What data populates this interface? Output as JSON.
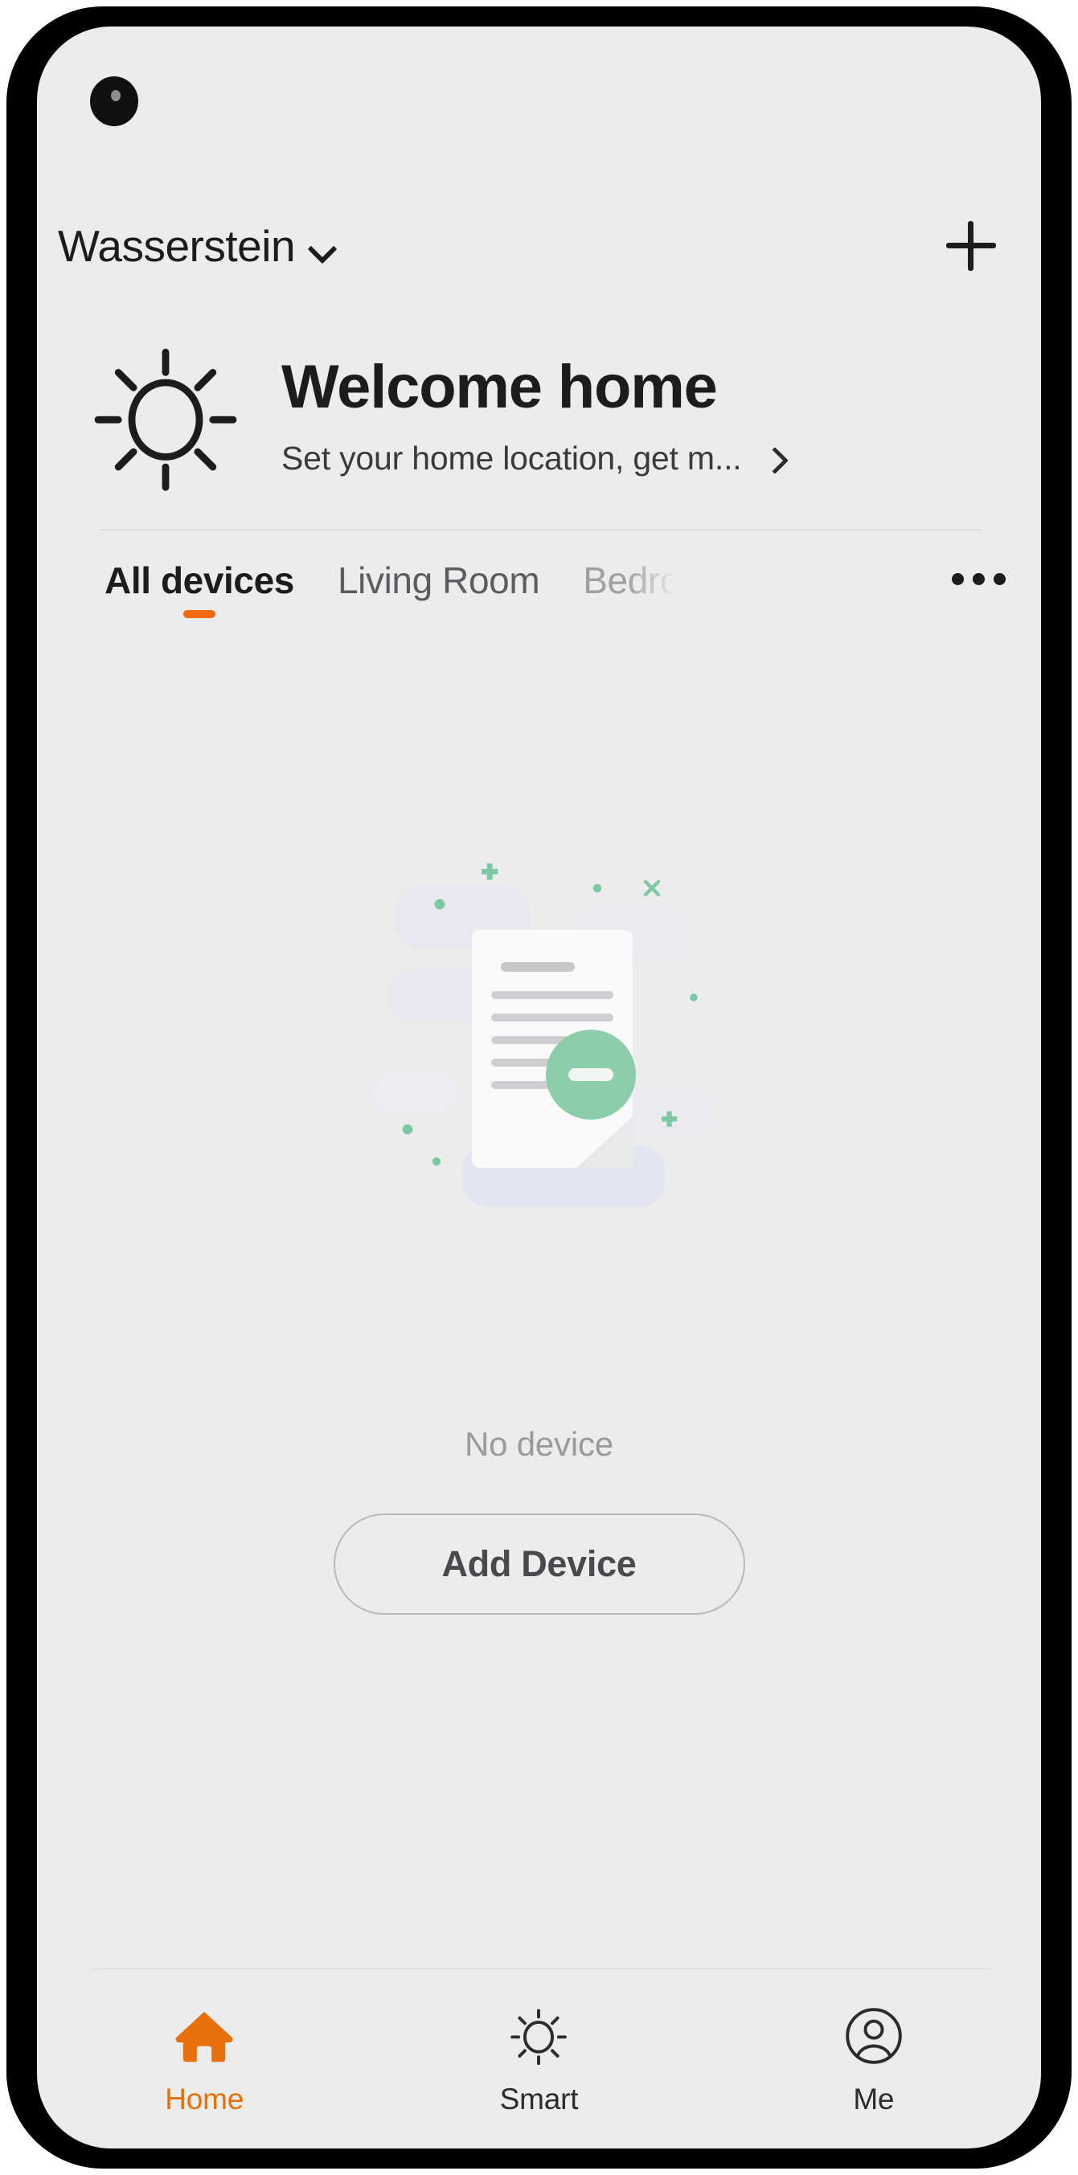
{
  "colors": {
    "accent_orange": "#E8700A",
    "tab_underline": "#F06A10",
    "screen_bg": "#ECECEC",
    "bezel": "#000000",
    "text_primary": "#1c1c1e",
    "text_muted": "#9a9a9e",
    "illus_green": "#7BC9A4",
    "illus_blue": "#E4E6F4"
  },
  "status": {
    "camera_icon": "front-camera-punch-hole"
  },
  "topbar": {
    "home_name": "Wasserstein",
    "dropdown_icon": "chevron-down-icon",
    "add_icon": "plus-icon"
  },
  "welcome": {
    "weather_icon": "sun-icon",
    "title": "Welcome home",
    "subtitle": "Set your home location, get m...",
    "chevron_icon": "chevron-right-icon"
  },
  "tabs": {
    "items": [
      {
        "label": "All devices",
        "state": "active"
      },
      {
        "label": "Living Room",
        "state": "inactive"
      },
      {
        "label": "Bedroom",
        "state": "faded"
      }
    ],
    "more_icon": "ellipsis-horizontal-icon"
  },
  "empty_state": {
    "illustration": "no-data-document-illustration",
    "message": "No device",
    "add_button_label": "Add Device"
  },
  "bottomnav": {
    "items": [
      {
        "label": "Home",
        "icon": "home-icon",
        "state": "active"
      },
      {
        "label": "Smart",
        "icon": "sun-icon",
        "state": "idle"
      },
      {
        "label": "Me",
        "icon": "person-circle-icon",
        "state": "idle"
      }
    ]
  }
}
